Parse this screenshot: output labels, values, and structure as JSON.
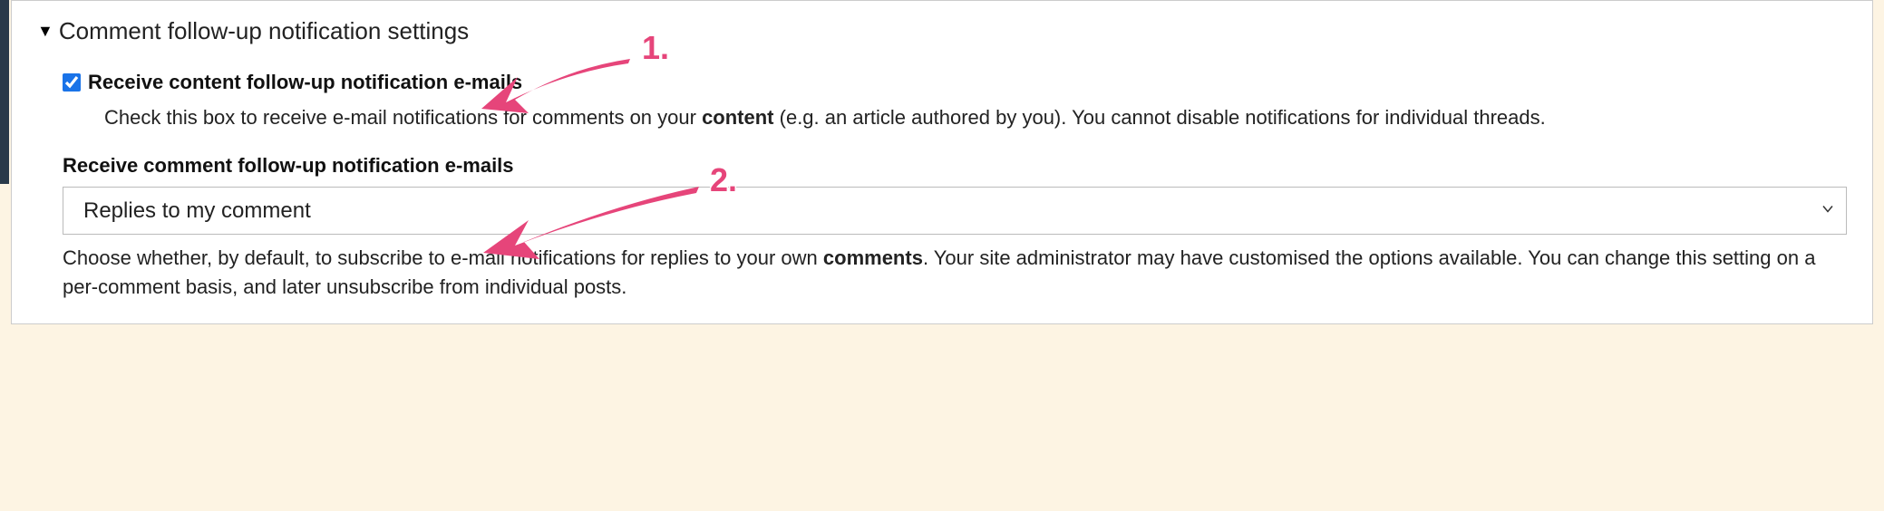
{
  "fieldset": {
    "legend": "Comment follow-up notification settings"
  },
  "option1": {
    "checked": true,
    "label": "Receive content follow-up notification e-mails",
    "help_pre": "Check this box to receive e-mail notifications for comments on your ",
    "help_bold": "content",
    "help_post": " (e.g. an article authored by you). You cannot disable notifications for individual threads."
  },
  "option2": {
    "label": "Receive comment follow-up notification e-mails",
    "selected": "Replies to my comment",
    "help_pre": "Choose whether, by default, to subscribe to e-mail notifications for replies to your own ",
    "help_bold": "comments",
    "help_post": ". Your site administrator may have customised the options available. You can change this setting on a per-comment basis, and later unsubscribe from individual posts."
  },
  "annotations": {
    "one": "1.",
    "two": "2."
  }
}
